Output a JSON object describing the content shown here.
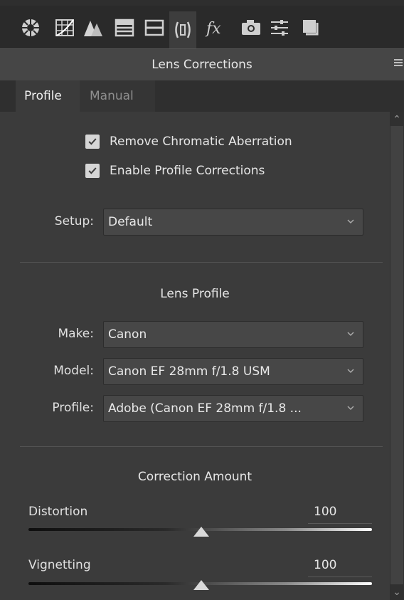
{
  "toolbar": {
    "tools": [
      "basic-icon",
      "tone-curve-icon",
      "detail-icon",
      "hsl-icon",
      "split-toning-icon",
      "lens-corrections-icon",
      "effects-icon",
      "camera-calibration-icon",
      "presets-icon",
      "snapshots-icon"
    ],
    "active_tool": "lens-corrections-icon"
  },
  "panel": {
    "title": "Lens Corrections"
  },
  "tabs": [
    {
      "label": "Profile",
      "active": true
    },
    {
      "label": "Manual",
      "active": false
    }
  ],
  "options": {
    "remove_ca": {
      "label": "Remove Chromatic Aberration",
      "checked": true
    },
    "enable_profile": {
      "label": "Enable Profile Corrections",
      "checked": true
    }
  },
  "setup": {
    "label": "Setup:",
    "value": "Default"
  },
  "lens_profile": {
    "title": "Lens Profile",
    "make": {
      "label": "Make:",
      "value": "Canon"
    },
    "model": {
      "label": "Model:",
      "value": "Canon EF 28mm f/1.8 USM"
    },
    "profile": {
      "label": "Profile:",
      "value": "Adobe (Canon EF 28mm f/1.8 ..."
    }
  },
  "correction": {
    "title": "Correction Amount",
    "distortion": {
      "label": "Distortion",
      "value": "100"
    },
    "vignetting": {
      "label": "Vignetting",
      "value": "100"
    }
  },
  "colors": {
    "background": "#3b3b3b",
    "toolbar": "#2a2a2a",
    "text": "#e6e6e6",
    "checkbox": "#d6d6d6"
  }
}
